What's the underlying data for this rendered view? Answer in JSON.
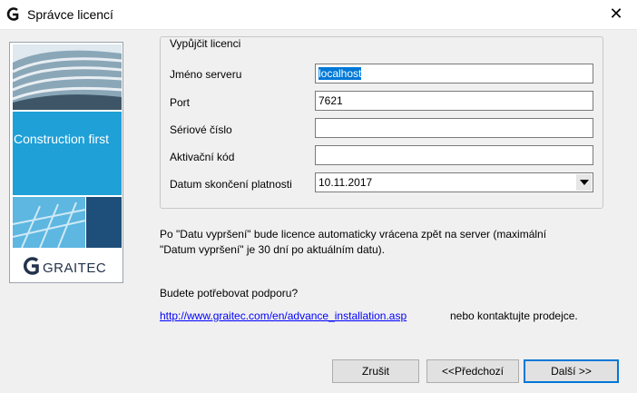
{
  "window": {
    "title": "Správce licencí",
    "close_glyph": "✕"
  },
  "sidebar": {
    "slogan": "Construction first",
    "logo_text": "GRAITEC",
    "colors": {
      "blue": "#1fa0d7",
      "dark_blue": "#1d4f7a"
    }
  },
  "group": {
    "legend": "Vypůjčit licenci",
    "fields": {
      "server": {
        "label": "Jméno serveru",
        "value": "localhost"
      },
      "port": {
        "label": "Port",
        "value": "7621"
      },
      "serial": {
        "label": "Sériové číslo",
        "value": ""
      },
      "activation": {
        "label": "Aktivační kód",
        "value": ""
      },
      "expiry": {
        "label": "Datum skončení platnosti",
        "value": "10.11.2017"
      }
    }
  },
  "info": {
    "note_line1": "Po \"Datu vypršení\" bude licence automaticky vrácena zpět na server (maximální",
    "note_line2": "\"Datum vypršení\" je 30 dní po aktuálním datu).",
    "support": "Budete potřebovat podporu?",
    "link": "http://www.graitec.com/en/advance_installation.asp",
    "contact": "nebo kontaktujte prodejce."
  },
  "buttons": {
    "cancel": "Zrušit",
    "previous": "<<Předchozí",
    "next": "Další >>"
  }
}
